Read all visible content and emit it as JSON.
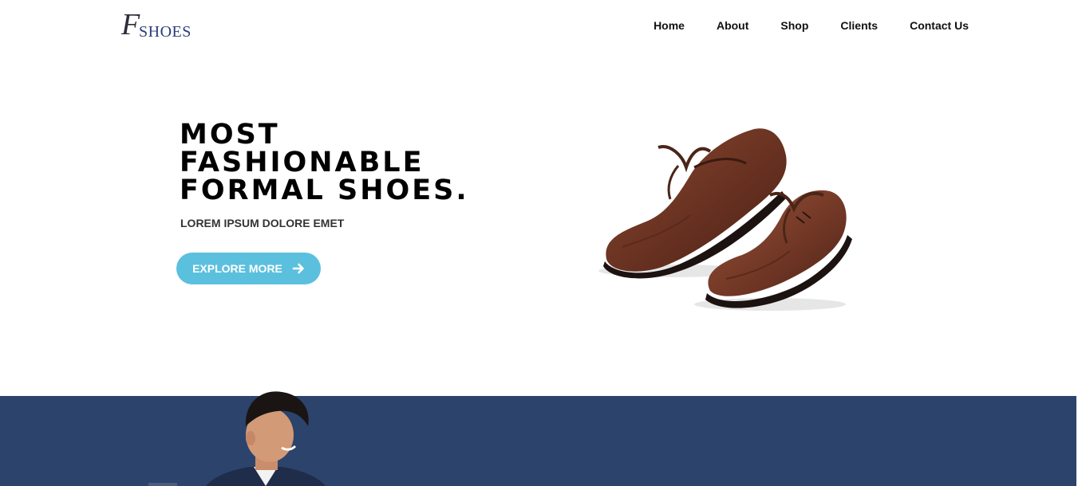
{
  "header": {
    "logo": {
      "initial": "F",
      "word": "SHOES"
    },
    "nav": [
      {
        "label": "Home"
      },
      {
        "label": "About"
      },
      {
        "label": "Shop"
      },
      {
        "label": "Clients"
      },
      {
        "label": "Contact Us"
      }
    ]
  },
  "hero": {
    "title": "MOST\nFASHIONABLE\nFORMAL SHOES.",
    "subtitle": "LOREM IPSUM DOLORE EMET",
    "cta_label": "EXPLORE MORE",
    "cta_icon": "arrow-right-icon",
    "cta_color": "#5bc0de"
  },
  "images": {
    "hero_product": "brown-formal-shoes",
    "section_model": "man-in-suit"
  },
  "colors": {
    "band": "#2c446c",
    "logo_word": "#2a3d7a"
  }
}
